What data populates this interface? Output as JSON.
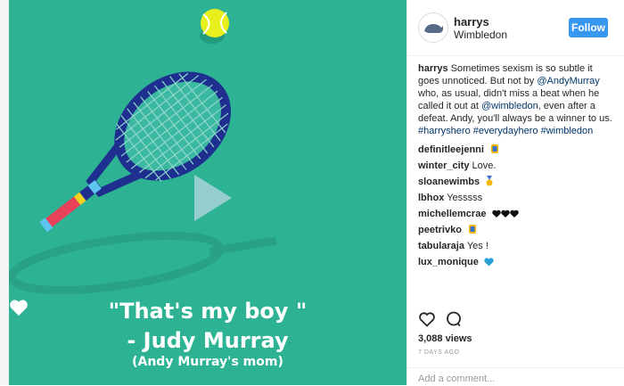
{
  "post": {
    "username": "harrys",
    "location": "Wimbledon",
    "follow_label": "Follow",
    "caption_user": "harrys",
    "caption_text_1": " Sometimes sexism is so subtle it goes unnoticed. But not by ",
    "mention_1": "@AndyMurray",
    "caption_text_2": " who, as usual, didn't miss a beat when he called it out at ",
    "mention_2": "@wimbledon",
    "caption_text_3": ", even after a defeat. Andy, you'll always be a winner to us.",
    "hashtags": "#harryshero #everydayhero #wimbledon",
    "views": "3,088 views",
    "time_ago": "7 DAYS AGO",
    "add_comment_placeholder": "Add a comment..."
  },
  "media": {
    "quote_line1": "\"That's my boy",
    "quote_line1_end": "\"",
    "quote_line2": "- Judy Murray",
    "quote_line3": "(Andy Murray's mom)",
    "background_color": "#2db394"
  },
  "comments": [
    {
      "user": "definitleejenni",
      "text": "",
      "emoji": "medal-icon"
    },
    {
      "user": "winter_city",
      "text": "Love.",
      "emoji": ""
    },
    {
      "user": "sloanewimbs",
      "text": "",
      "emoji": "medal-icon"
    },
    {
      "user": "lbhox",
      "text": "Yesssss",
      "emoji": ""
    },
    {
      "user": "michellemcrae",
      "text": "",
      "emoji": "black-hearts-icon"
    },
    {
      "user": "peetrivko",
      "text": "",
      "emoji": "medal-icon"
    },
    {
      "user": "tabularaja",
      "text": "Yes !",
      "emoji": ""
    },
    {
      "user": "lux_monique",
      "text": "",
      "emoji": "blue-heart-icon"
    }
  ],
  "colors": {
    "accent": "#3897f0",
    "link": "#003569",
    "text": "#262626"
  }
}
